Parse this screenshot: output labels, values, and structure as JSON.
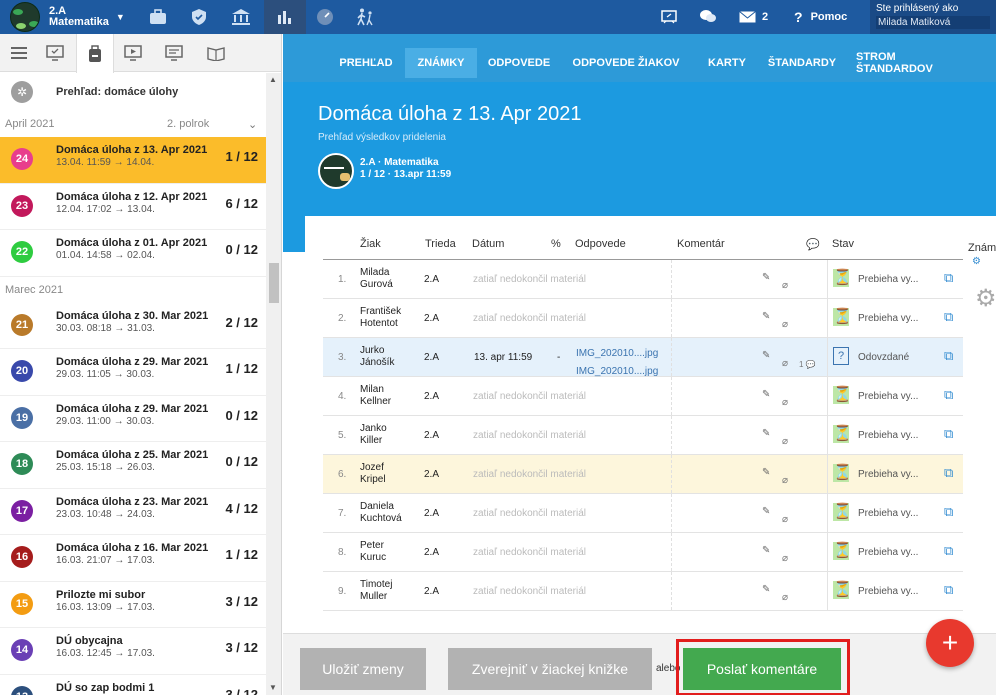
{
  "topbar": {
    "class_number": "2.A",
    "class_subject": "Matematika",
    "icons": [
      "briefcase-icon",
      "shield-icon",
      "bank-icon",
      "chart-icon",
      "gauge-icon",
      "walk-icon"
    ],
    "mail_count": "2",
    "help": "Pomoc",
    "login_label": "Ste prihlásený ako",
    "login_user": "Milada Matiková"
  },
  "sidebar": {
    "overview": "Prehľad: domáce úlohy",
    "semester": "2. polrok",
    "months": [
      "April 2021",
      "Marec 2021"
    ],
    "items": [
      {
        "num": "24",
        "color": "#e83e8c",
        "title": "Domáca úloha z 13. Apr 2021",
        "date": "13.04. 11:59 → 14.04.",
        "count": "1 / 12",
        "month": 0,
        "sel": true
      },
      {
        "num": "23",
        "color": "#c2185b",
        "title": "Domáca úloha z 12. Apr 2021",
        "date": "12.04. 17:02 → 13.04.",
        "count": "6 / 12",
        "month": 0
      },
      {
        "num": "22",
        "color": "#2ecc40",
        "title": "Domáca úloha z 01. Apr 2021",
        "date": "01.04. 14:58 → 02.04.",
        "count": "0 / 12",
        "month": 0
      },
      {
        "num": "21",
        "color": "#b97a2a",
        "title": "Domáca úloha z 30. Mar 2021",
        "date": "30.03. 08:18 → 31.03.",
        "count": "2 / 12",
        "month": 1
      },
      {
        "num": "20",
        "color": "#3949ab",
        "title": "Domáca úloha z 29. Mar 2021",
        "date": "29.03. 11:05 → 30.03.",
        "count": "1 / 12",
        "month": 1
      },
      {
        "num": "19",
        "color": "#4a6fa5",
        "title": "Domáca úloha z 29. Mar 2021",
        "date": "29.03. 11:00 → 30.03.",
        "count": "0 / 12",
        "month": 1
      },
      {
        "num": "18",
        "color": "#2e8b57",
        "title": "Domáca úloha z 25. Mar 2021",
        "date": "25.03. 15:18 → 26.03.",
        "count": "0 / 12",
        "month": 1
      },
      {
        "num": "17",
        "color": "#7b1fa2",
        "title": "Domáca úloha z 23. Mar 2021",
        "date": "23.03. 10:48 → 24.03.",
        "count": "4 / 12",
        "month": 1
      },
      {
        "num": "16",
        "color": "#a51c1c",
        "title": "Domáca úloha z 16. Mar 2021",
        "date": "16.03. 21:07 → 17.03.",
        "count": "1 / 12",
        "month": 1
      },
      {
        "num": "15",
        "color": "#f39c12",
        "title": "Prilozte mi subor",
        "date": "16.03. 13:09 → 17.03.",
        "count": "3 / 12",
        "month": 1
      },
      {
        "num": "14",
        "color": "#6a3fb5",
        "title": "DÚ obycajna",
        "date": "16.03. 12:45 → 17.03.",
        "count": "3 / 12",
        "month": 1
      },
      {
        "num": "13",
        "color": "#2c4f7d",
        "title": "DÚ so zap bodmi 1",
        "date": "",
        "count": "3 / 12",
        "month": 1
      }
    ]
  },
  "nav": [
    "PREHĽAD",
    "ZNÁMKY",
    "ODPOVEDE",
    "ODPOVEDE ŽIAKOV",
    "KARTY",
    "ŠTANDARDY",
    "STROM ŠTANDARDOV"
  ],
  "hero": {
    "title": "Domáca úloha z 13. Apr 2021",
    "subtitle": "Prehľad výsledkov pridelenia",
    "class_line": "2.A · Matematika",
    "detail_line": "1 / 12 · 13.apr 11:59"
  },
  "table": {
    "headers": {
      "student": "Žiak",
      "class": "Trieda",
      "date": "Dátum",
      "percent": "%",
      "answers": "Odpovede",
      "comment": "Komentár",
      "status": "Stav",
      "grade": "Znám"
    },
    "pending_text": "zatiaľ nedokončil materiál",
    "rows": [
      {
        "idx": "1.",
        "first": "Milada",
        "last": "Gurová",
        "class": "2.A",
        "status": "Prebieha vy..."
      },
      {
        "idx": "2.",
        "first": "František",
        "last": "Hotentot",
        "class": "2.A",
        "status": "Prebieha vy..."
      },
      {
        "idx": "3.",
        "first": "Jurko",
        "last": "Jánošík",
        "class": "2.A",
        "date": "13. apr 11:59",
        "pct": "-",
        "file1": "IMG_202010....jpg",
        "file2": "IMG_202010....jpg",
        "ccount": "1",
        "status": "Odovzdané",
        "hl": true
      },
      {
        "idx": "4.",
        "first": "Milan",
        "last": "Kellner",
        "class": "2.A",
        "status": "Prebieha vy..."
      },
      {
        "idx": "5.",
        "first": "Janko",
        "last": "Killer",
        "class": "2.A",
        "status": "Prebieha vy..."
      },
      {
        "idx": "6.",
        "first": "Jozef",
        "last": "Kripel",
        "class": "2.A",
        "status": "Prebieha vy...",
        "yl": true
      },
      {
        "idx": "7.",
        "first": "Daniela",
        "last": "Kuchtová",
        "class": "2.A",
        "status": "Prebieha vy..."
      },
      {
        "idx": "8.",
        "first": "Peter",
        "last": "Kuruc",
        "class": "2.A",
        "status": "Prebieha vy..."
      },
      {
        "idx": "9.",
        "first": "Timotej",
        "last": "Muller",
        "class": "2.A",
        "status": "Prebieha vy..."
      }
    ]
  },
  "buttons": {
    "save": "Uložiť zmeny",
    "publish": "Zverejniť v žiackej knižke",
    "or": "alebo",
    "send": "Poslať komentáre"
  }
}
